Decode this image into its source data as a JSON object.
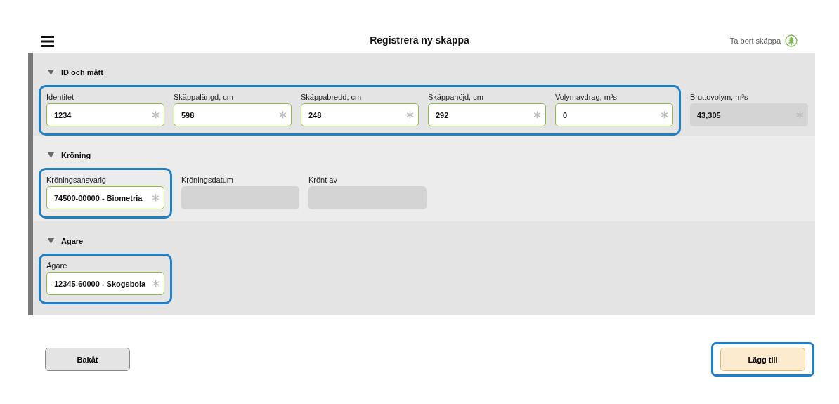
{
  "header": {
    "title": "Registrera ny skäppa",
    "delete_label": "Ta bort skäppa"
  },
  "sections": [
    {
      "title": "ID och mått",
      "expanded": true,
      "groups": [
        {
          "highlighted": true,
          "fields": [
            {
              "label": "Identitet",
              "value": "1234",
              "required": true,
              "disabled": false
            },
            {
              "label": "Skäppalängd, cm",
              "value": "598",
              "required": true,
              "disabled": false
            },
            {
              "label": "Skäppabredd, cm",
              "value": "248",
              "required": true,
              "disabled": false
            },
            {
              "label": "Skäppahöjd, cm",
              "value": "292",
              "required": true,
              "disabled": false
            },
            {
              "label": "Volymavdrag, m³s",
              "value": "0",
              "required": true,
              "disabled": false
            }
          ]
        },
        {
          "highlighted": false,
          "fields": [
            {
              "label": "Bruttovolym, m³s",
              "value": "43,305",
              "required": true,
              "disabled": true
            }
          ]
        }
      ]
    },
    {
      "title": "Kröning",
      "expanded": true,
      "groups": [
        {
          "highlighted": true,
          "fields": [
            {
              "label": "Kröningsansvarig",
              "value": "74500-00000 - Biometria",
              "required": true,
              "disabled": false
            }
          ]
        },
        {
          "highlighted": false,
          "fields": [
            {
              "label": "Kröningsdatum",
              "required": false,
              "disabled": true
            },
            {
              "label": "Krönt av",
              "required": false,
              "disabled": true
            }
          ]
        }
      ]
    },
    {
      "title": "Ägare",
      "expanded": true,
      "groups": [
        {
          "highlighted": true,
          "fields": [
            {
              "label": "Ägare",
              "value": "12345-60000 - Skogsbola",
              "required": true,
              "disabled": false
            }
          ]
        }
      ]
    }
  ],
  "buttons": [
    {
      "label": "Bakåt",
      "kind": "secondary",
      "highlighted": false
    },
    {
      "label": "Lägg till",
      "kind": "primary",
      "highlighted": true
    }
  ]
}
